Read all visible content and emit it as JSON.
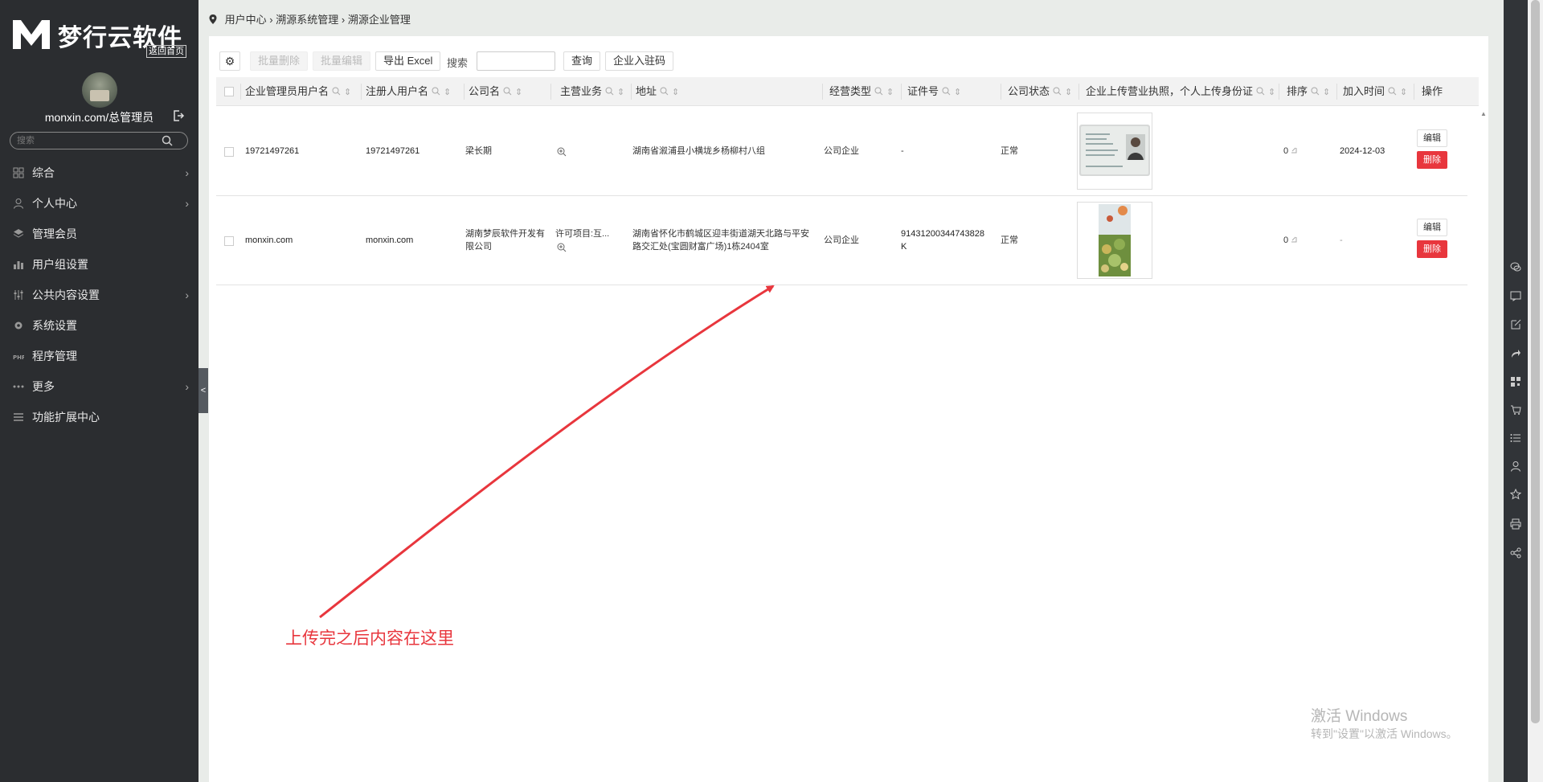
{
  "sidebar": {
    "logo_text": "梦行云软件",
    "home_link": "返回首页",
    "username": "monxin.com/总管理员",
    "search_placeholder": "搜索",
    "menu": [
      {
        "label": "综合",
        "icon": "grid-icon",
        "has_children": true
      },
      {
        "label": "个人中心",
        "icon": "user-icon",
        "has_children": true
      },
      {
        "label": "管理会员",
        "icon": "layers-icon",
        "has_children": false
      },
      {
        "label": "用户组设置",
        "icon": "bar-chart-icon",
        "has_children": false
      },
      {
        "label": "公共内容设置",
        "icon": "sliders-icon",
        "has_children": true
      },
      {
        "label": "系统设置",
        "icon": "gear-icon",
        "has_children": false
      },
      {
        "label": "程序管理",
        "icon": "php-icon",
        "has_children": false
      },
      {
        "label": "更多",
        "icon": "more-dots-icon",
        "has_children": true
      },
      {
        "label": "功能扩展中心",
        "icon": "list-icon",
        "has_children": false
      }
    ],
    "chevron": "›",
    "collapse": "<"
  },
  "breadcrumb": {
    "items": [
      "用户中心",
      "溯源系统管理",
      "溯源企业管理"
    ],
    "separator": "›"
  },
  "toolbar": {
    "gear": "⚙",
    "bulk_delete": "批量删除",
    "bulk_edit": "批量编辑",
    "export_excel": "导出 Excel",
    "search_label": "搜索",
    "search_value": "",
    "query": "查询",
    "enterprise_code": "企业入驻码"
  },
  "table": {
    "headers": [
      "企业管理员用户名",
      "注册人用户名",
      "公司名",
      "主营业务",
      "地址",
      "经营类型",
      "证件号",
      "公司状态",
      "企业上传营业执照，个人上传身份证",
      "排序",
      "加入时间",
      "操作"
    ],
    "sort_glyph": "⇕",
    "rows": [
      {
        "admin_user": "19721497261",
        "registrant": "19721497261",
        "company": "梁长期",
        "business": "",
        "address": "湖南省溆浦县小横垅乡杨柳村八组",
        "biz_type": "公司企业",
        "license_no": "-",
        "status": "正常",
        "sort": "0",
        "join_time": "2024-12-03",
        "edit": "编辑",
        "delete": "删除"
      },
      {
        "admin_user": "monxin.com",
        "registrant": "monxin.com",
        "company": "湖南梦辰软件开发有限公司",
        "business": "许可项目:互...",
        "address": "湖南省怀化市鹤城区迎丰街道湖天北路与平安路交汇处(宝圆财富广场)1栋2404室",
        "biz_type": "公司企业",
        "license_no": "91431200344743828K",
        "status": "正常",
        "sort": "0",
        "join_time": "-",
        "edit": "编辑",
        "delete": "删除"
      }
    ]
  },
  "annotation": {
    "text": "上传完之后内容在这里",
    "color": "#e8363d"
  },
  "watermark": {
    "line1": "激活 Windows",
    "line2": "转到\"设置\"以激活 Windows。"
  },
  "right_rail_icons": [
    "chat-icon",
    "message-icon",
    "edit-icon",
    "share-arrow-icon",
    "qr-icon",
    "cart-icon",
    "list-icon",
    "user-icon",
    "star-icon",
    "print-icon",
    "share-icon"
  ],
  "colors": {
    "sidebar_bg": "#2b2d30",
    "danger": "#e8363d",
    "page_bg": "#e9ece9"
  }
}
